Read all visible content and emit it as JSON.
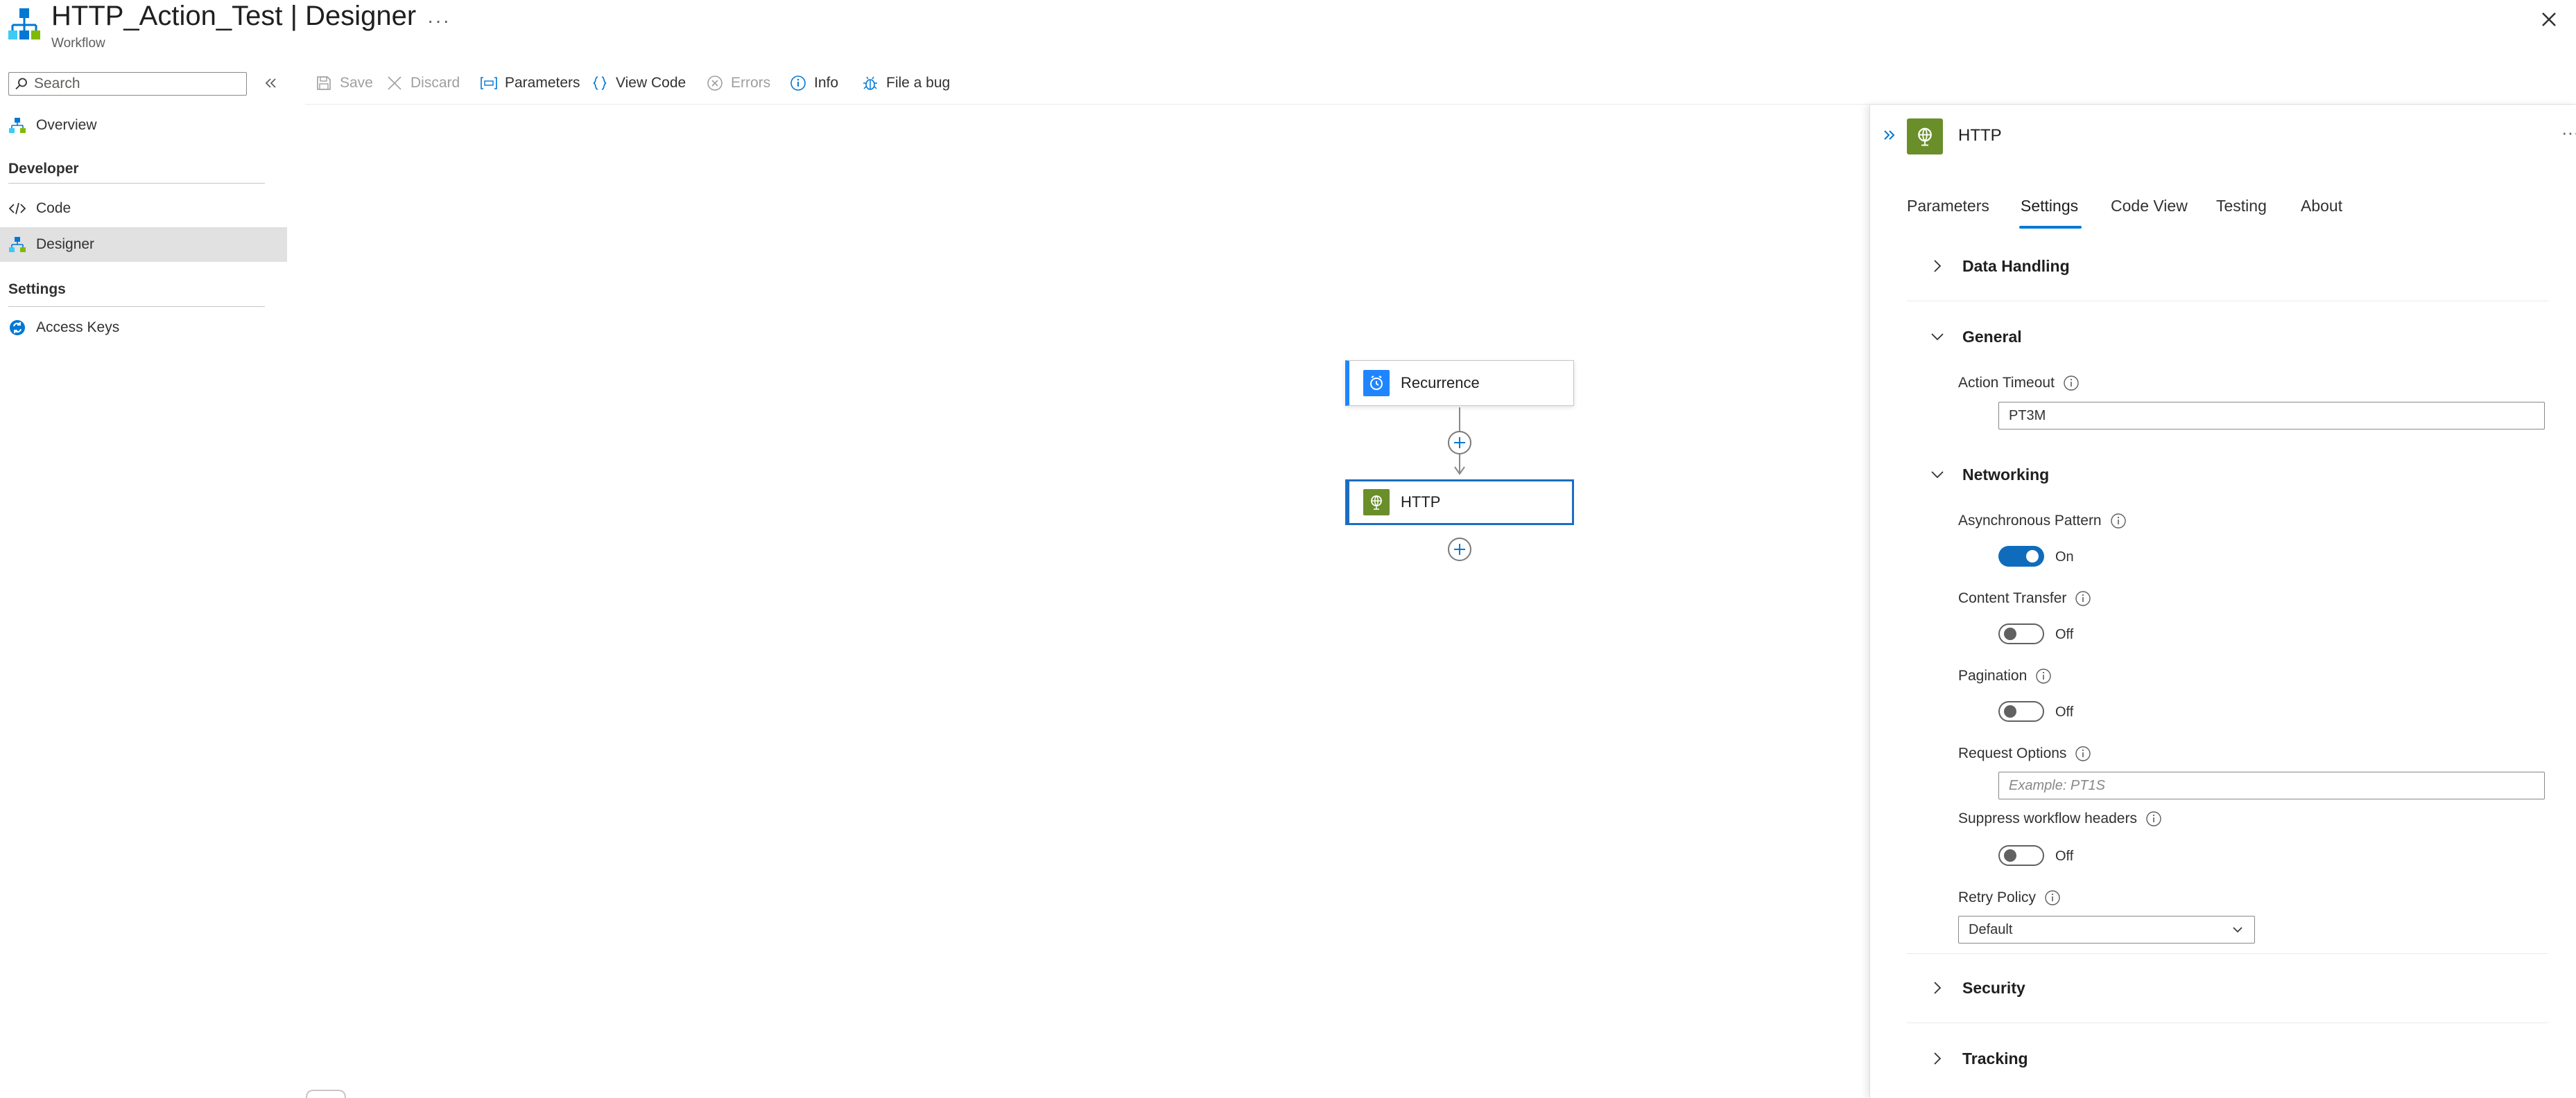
{
  "header": {
    "title_name": "HTTP_Action_Test",
    "title_separator": "|",
    "title_view": "Designer",
    "more_label": "···",
    "subtitle": "Workflow",
    "app_icon": "workflow-icon",
    "close_icon": "close-icon"
  },
  "sidebar": {
    "search_placeholder": "Search",
    "items": [
      {
        "label": "Overview",
        "icon": "workflow-icon"
      },
      {
        "label": "Code",
        "icon": "code-icon"
      },
      {
        "label": "Designer",
        "icon": "workflow-icon",
        "selected": true
      },
      {
        "label": "Access Keys",
        "icon": "keys-icon"
      }
    ],
    "sections": {
      "developer": "Developer",
      "settings": "Settings"
    }
  },
  "toolbar": {
    "save": "Save",
    "discard": "Discard",
    "parameters": "Parameters",
    "view_code": "View Code",
    "errors": "Errors",
    "info": "Info",
    "file_bug": "File a bug"
  },
  "canvas": {
    "nodes": [
      {
        "label": "Recurrence",
        "icon": "clock-icon",
        "color": "#1f85ff"
      },
      {
        "label": "HTTP",
        "icon": "globe-icon",
        "color": "#6a8f2a",
        "selected": true
      }
    ]
  },
  "panel": {
    "title": "HTTP",
    "more_label": "···",
    "tabs": [
      "Parameters",
      "Settings",
      "Code View",
      "Testing",
      "About"
    ],
    "active_tab": "Settings",
    "sections": {
      "data_handling": "Data Handling",
      "general": "General",
      "networking": "Networking",
      "security": "Security",
      "tracking": "Tracking"
    },
    "fields": {
      "action_timeout_label": "Action Timeout",
      "action_timeout_value": "PT3M",
      "async_pattern_label": "Asynchronous Pattern",
      "async_pattern_state": "On",
      "content_transfer_label": "Content Transfer",
      "content_transfer_state": "Off",
      "pagination_label": "Pagination",
      "pagination_state": "Off",
      "request_options_label": "Request Options",
      "request_options_placeholder": "Example: PT1S",
      "suppress_headers_label": "Suppress workflow headers",
      "suppress_headers_state": "Off",
      "retry_policy_label": "Retry Policy",
      "retry_policy_value": "Default"
    }
  },
  "colors": {
    "accent": "#0078d4",
    "toggle_on": "#0f6cbd",
    "recurrence": "#1f85ff",
    "http": "#6a8f2a",
    "nav_selected": "#e1e1e1"
  }
}
